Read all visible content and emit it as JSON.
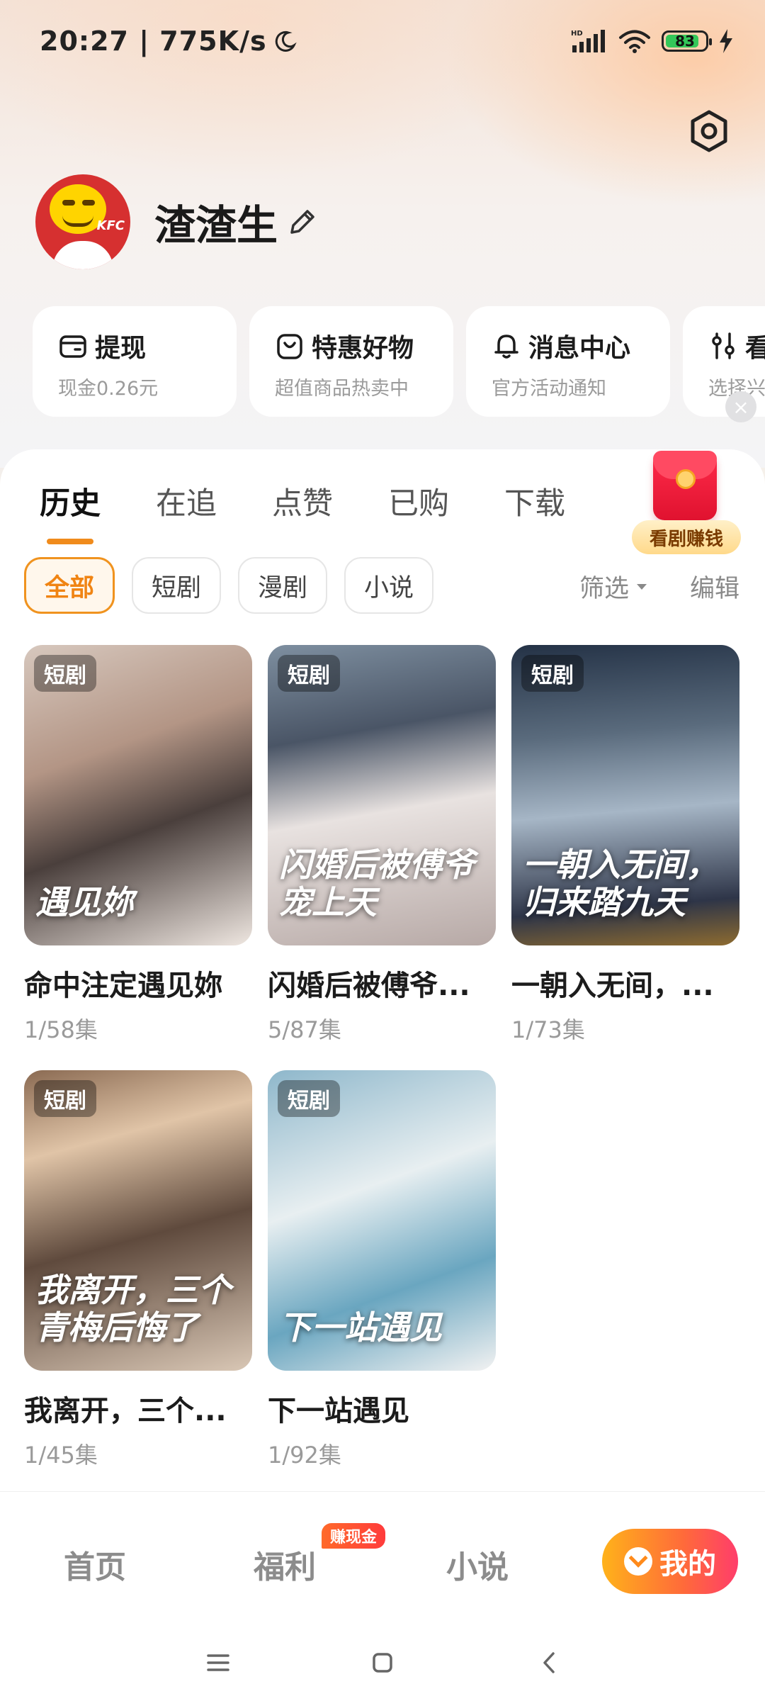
{
  "status_bar": {
    "time_speed": "20:27 | 775K/s",
    "battery_level": "83",
    "network_badge": "HD"
  },
  "profile": {
    "avatar_text": "KFC",
    "username": "渣渣生"
  },
  "quick_cards": [
    {
      "title": "提现",
      "subtitle": "现金0.26元",
      "icon": "wallet-icon"
    },
    {
      "title": "特惠好物",
      "subtitle": "超值商品热卖中",
      "icon": "shopping-bag-icon"
    },
    {
      "title": "消息中心",
      "subtitle": "官方活动通知",
      "icon": "bell-icon"
    },
    {
      "title": "看",
      "subtitle": "选择兴",
      "icon": "sliders-icon"
    }
  ],
  "tabs": [
    {
      "label": "历史",
      "active": true
    },
    {
      "label": "在追",
      "active": false
    },
    {
      "label": "点赞",
      "active": false
    },
    {
      "label": "已购",
      "active": false
    },
    {
      "label": "下载",
      "active": false
    }
  ],
  "promo": {
    "label": "看剧赚钱"
  },
  "chips": [
    {
      "label": "全部",
      "active": true
    },
    {
      "label": "短剧",
      "active": false
    },
    {
      "label": "漫剧",
      "active": false
    },
    {
      "label": "小说",
      "active": false
    }
  ],
  "filter_label": "筛选",
  "edit_label": "编辑",
  "items": [
    {
      "tag": "短剧",
      "poster_title": "遇见妳",
      "name": "命中注定遇见妳",
      "episodes": "1/58集"
    },
    {
      "tag": "短剧",
      "poster_title": "闪婚后被傅爷宠上天",
      "name": "闪婚后被傅爷...",
      "episodes": "5/87集"
    },
    {
      "tag": "短剧",
      "poster_title": "一朝入无间，归来踏九天",
      "name": "一朝入无间，...",
      "episodes": "1/73集"
    },
    {
      "tag": "短剧",
      "poster_title": "我离开，三个青梅后悔了",
      "name": "我离开，三个...",
      "episodes": "1/45集"
    },
    {
      "tag": "短剧",
      "poster_title": "下一站遇见",
      "name": "下一站遇见",
      "episodes": "1/92集"
    }
  ],
  "bottom_nav": {
    "home": "首页",
    "welfare": "福利",
    "welfare_badge": "赚现金",
    "novel": "小说",
    "me": "我的"
  },
  "colors": {
    "accent": "#f08b1c",
    "brand_gradient_start": "#ffb21a",
    "brand_gradient_end": "#ff3d6b"
  }
}
